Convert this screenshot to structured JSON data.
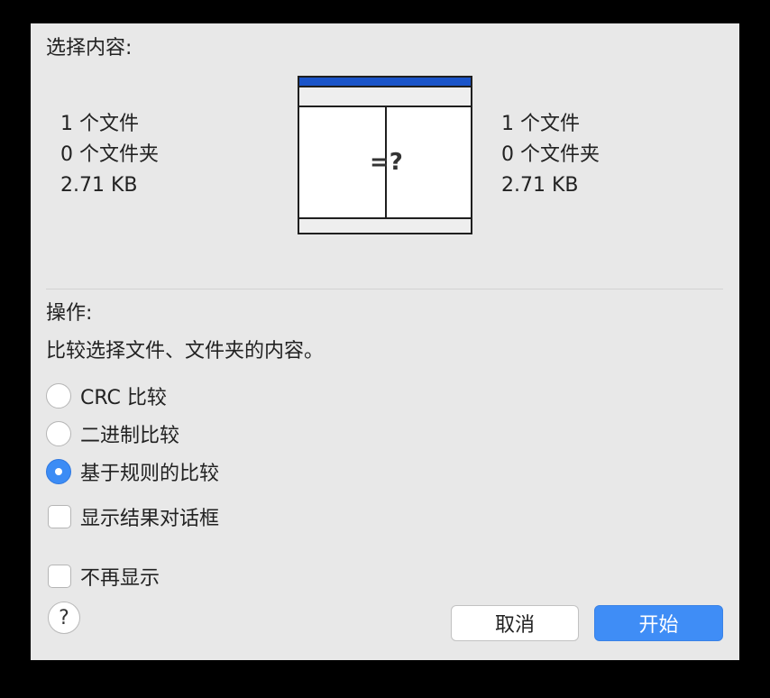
{
  "dialog": {
    "select_title": "选择内容:",
    "left_stats": {
      "files": "1 个文件",
      "folders": "0 个文件夹",
      "size": "2.71 KB"
    },
    "right_stats": {
      "files": "1 个文件",
      "folders": "0 个文件夹",
      "size": "2.71 KB"
    },
    "diagram_symbol": "=?",
    "operation_title": "操作:",
    "operation_desc": "比较选择文件、文件夹的内容。",
    "radio_options": [
      {
        "label": "CRC 比较",
        "selected": false
      },
      {
        "label": "二进制比较",
        "selected": false
      },
      {
        "label": "基于规则的比较",
        "selected": true
      }
    ],
    "show_result_checkbox": {
      "label": "显示结果对话框",
      "checked": false
    },
    "dont_show_checkbox": {
      "label": "不再显示",
      "checked": false
    },
    "help_label": "?",
    "cancel_label": "取消",
    "start_label": "开始"
  },
  "colors": {
    "accent": "#3f8df6",
    "diagram_titlebar": "#1a54c9",
    "dialog_bg": "#e8e8e8"
  }
}
